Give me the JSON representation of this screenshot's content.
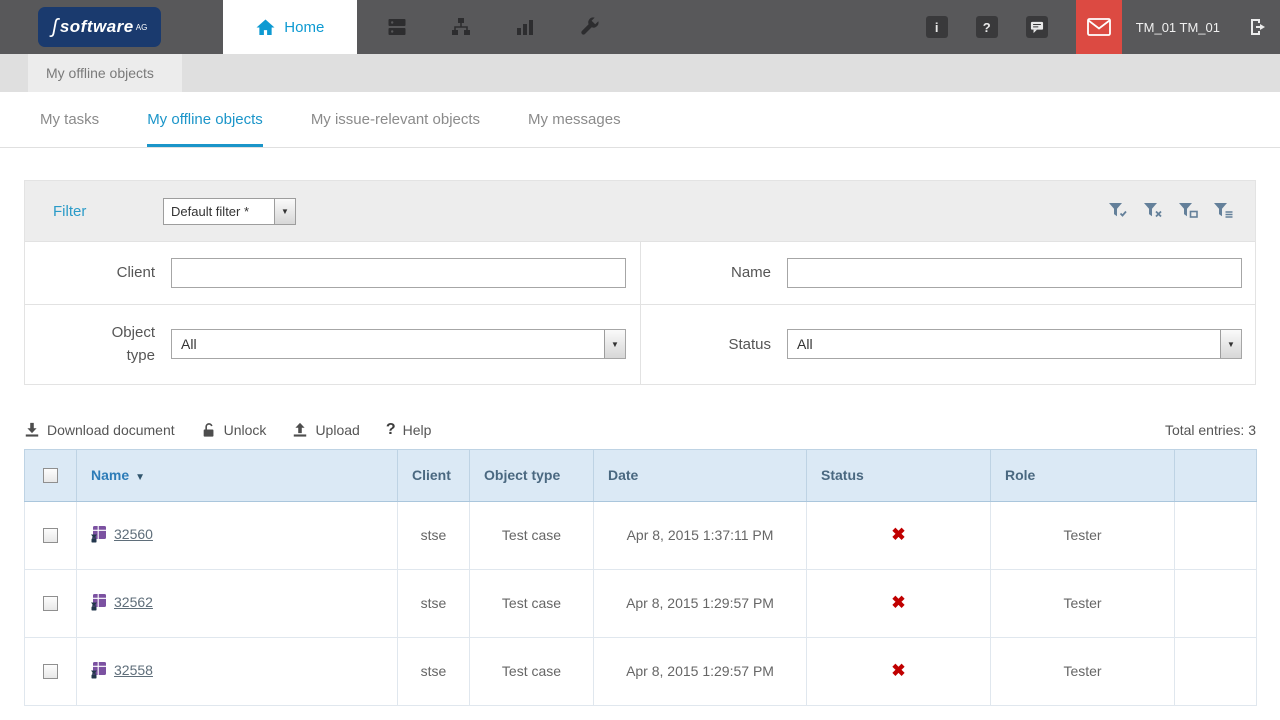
{
  "topbar": {
    "brand": "software",
    "brand_sup": "AG",
    "home_label": "Home",
    "user_name": "TM_01 TM_01",
    "info_glyph": "i",
    "help_glyph": "?"
  },
  "breadcrumb": {
    "label": "My offline objects"
  },
  "tabs": {
    "items": [
      {
        "label": "My tasks"
      },
      {
        "label": "My offline objects"
      },
      {
        "label": "My issue-relevant objects"
      },
      {
        "label": "My messages"
      }
    ]
  },
  "filter": {
    "title": "Filter",
    "preset_value": "Default filter *",
    "client_label": "Client",
    "client_value": "",
    "name_label": "Name",
    "name_value": "",
    "object_type_label": "Object type",
    "object_type_value": "All",
    "status_label": "Status",
    "status_value": "All"
  },
  "toolbar": {
    "download_label": "Download document",
    "unlock_label": "Unlock",
    "upload_label": "Upload",
    "help_label": "Help",
    "help_glyph": "?",
    "total_entries": "Total entries: 3"
  },
  "table": {
    "headers": {
      "name": "Name",
      "client": "Client",
      "object_type": "Object type",
      "date": "Date",
      "status": "Status",
      "role": "Role"
    },
    "sort_arrow": "▼",
    "rows": [
      {
        "name": "32560",
        "client": "stse",
        "object_type": "Test case",
        "date": "Apr 8, 2015 1:37:11 PM",
        "status": "✖",
        "role": "Tester"
      },
      {
        "name": "32562",
        "client": "stse",
        "object_type": "Test case",
        "date": "Apr 8, 2015 1:29:57 PM",
        "status": "✖",
        "role": "Tester"
      },
      {
        "name": "32558",
        "client": "stse",
        "object_type": "Test case",
        "date": "Apr 8, 2015 1:29:57 PM",
        "status": "✖",
        "role": "Tester"
      }
    ]
  },
  "colors": {
    "accent_blue": "#1b95c9",
    "status_red": "#c00000",
    "mail_red": "#dc4a42"
  }
}
